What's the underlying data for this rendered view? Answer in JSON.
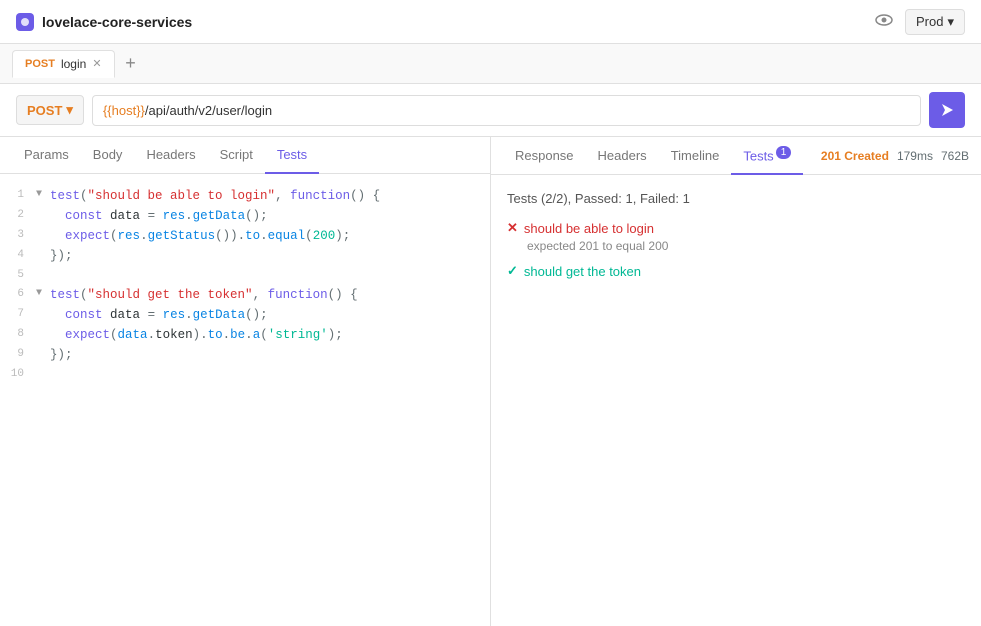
{
  "app": {
    "title": "lovelace-core-services",
    "icon_color": "#6c5ce7"
  },
  "env_button": {
    "label": "Prod",
    "dropdown_icon": "▾"
  },
  "tabs": [
    {
      "method": "POST",
      "label": "login",
      "closeable": true
    }
  ],
  "add_tab_label": "+",
  "url_bar": {
    "method": "POST",
    "url_prefix": "{{host}}",
    "url_path": "/api/auth/v2/user/login",
    "send_icon": "▶"
  },
  "left_panel": {
    "tabs": [
      "Params",
      "Body",
      "Headers",
      "Script",
      "Tests"
    ],
    "active_tab": "Tests",
    "code_lines": [
      {
        "num": 1,
        "fold": "▼",
        "content": "test(\"should be able to login\", function() {"
      },
      {
        "num": 2,
        "fold": "",
        "content": "  const data = res.getData();"
      },
      {
        "num": 3,
        "fold": "",
        "content": "  expect(res.getStatus()).to.equal(200);"
      },
      {
        "num": 4,
        "fold": "",
        "content": "});"
      },
      {
        "num": 5,
        "fold": "",
        "content": ""
      },
      {
        "num": 6,
        "fold": "▼",
        "content": "test(\"should get the token\", function() {"
      },
      {
        "num": 7,
        "fold": "",
        "content": "  const data = res.getData();"
      },
      {
        "num": 8,
        "fold": "",
        "content": "  expect(data.token).to.be.a('string');"
      },
      {
        "num": 9,
        "fold": "",
        "content": "});"
      },
      {
        "num": 10,
        "fold": "",
        "content": ""
      }
    ]
  },
  "right_panel": {
    "tabs": [
      "Response",
      "Headers",
      "Timeline",
      "Tests"
    ],
    "active_tab": "Tests",
    "tests_badge": "1",
    "status": "201 Created",
    "time": "179ms",
    "size": "762B",
    "test_summary": "Tests (2/2), Passed: 1, Failed: 1",
    "test_results": [
      {
        "status": "fail",
        "label": "should be able to login",
        "detail": "expected 201 to equal 200"
      },
      {
        "status": "pass",
        "label": "should get the token",
        "detail": ""
      }
    ]
  }
}
